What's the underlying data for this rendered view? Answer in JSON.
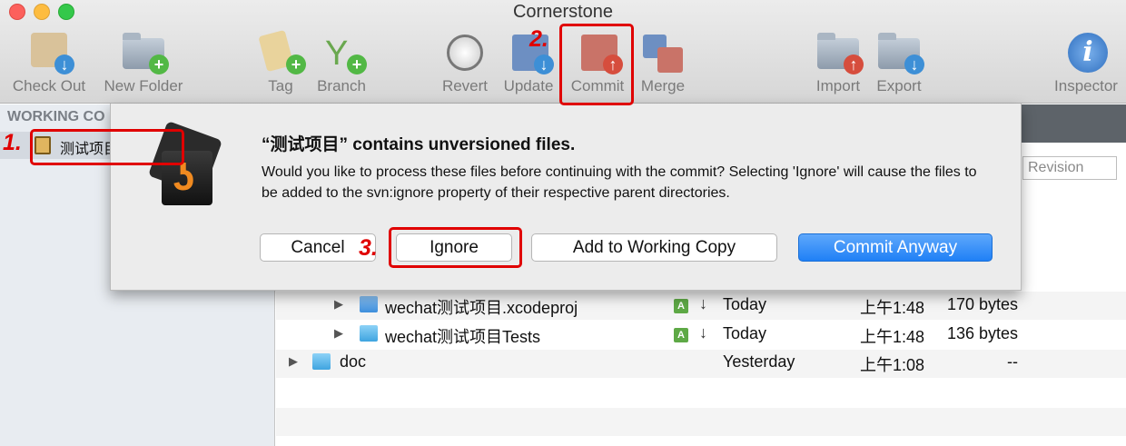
{
  "window": {
    "title": "Cornerstone"
  },
  "toolbar": {
    "items": [
      {
        "label": "Check Out"
      },
      {
        "label": "New Folder"
      },
      {
        "label": "Tag"
      },
      {
        "label": "Branch"
      },
      {
        "label": "Revert"
      },
      {
        "label": "Update"
      },
      {
        "label": "Commit"
      },
      {
        "label": "Merge"
      },
      {
        "label": "Import"
      },
      {
        "label": "Export"
      },
      {
        "label": "Inspector"
      }
    ]
  },
  "sidebar": {
    "header": "WORKING CO",
    "selected_item": "测试项目"
  },
  "main": {
    "revision_placeholder": "Revision",
    "rows": [
      {
        "name": "wechat测试项目.xcodeproj",
        "status": "A",
        "date": "Today",
        "time": "上午1:48",
        "size": "170 bytes"
      },
      {
        "name": "wechat测试项目Tests",
        "status": "A",
        "date": "Today",
        "time": "上午1:48",
        "size": "136 bytes"
      },
      {
        "name": "doc",
        "status": "",
        "date": "Yesterday",
        "time": "上午1:08",
        "size": "--"
      }
    ]
  },
  "dialog": {
    "title": "“测试项目” contains unversioned files.",
    "body": "Would you like to process these files before continuing with the commit? Selecting 'Ignore' will cause the files to be added to the svn:ignore property of their respective parent directories.",
    "buttons": {
      "cancel": "Cancel",
      "ignore": "Ignore",
      "add": "Add to Working Copy",
      "commit": "Commit Anyway"
    }
  },
  "annotations": {
    "step1": "1.",
    "step2": "2.",
    "step3": "3.",
    "color": "#e00000"
  },
  "icons": {
    "logo_mark": "ʖ",
    "info": "i",
    "status_a": "A",
    "arrow": "↓",
    "disclosure": "▶"
  }
}
